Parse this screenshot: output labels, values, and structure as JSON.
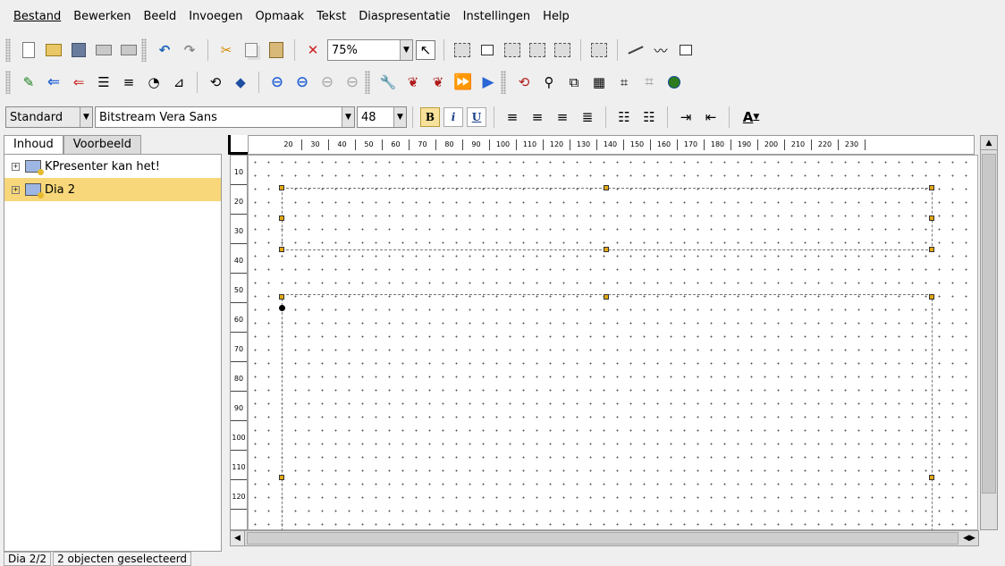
{
  "menu": [
    "Bestand",
    "Bewerken",
    "Beeld",
    "Invoegen",
    "Opmaak",
    "Tekst",
    "Diaspresentatie",
    "Instellingen",
    "Help"
  ],
  "toolbar1": {
    "zoom_value": "75%"
  },
  "format_toolbar": {
    "style_value": "Standard",
    "font_value": "Bitstream Vera Sans",
    "size_value": "48",
    "bold_label": "B",
    "italic_label": "i",
    "underline_label": "U",
    "text_color_label": "A"
  },
  "panel": {
    "tabs": [
      "Inhoud",
      "Voorbeeld"
    ],
    "slides": [
      {
        "title": "KPresenter kan het!",
        "selected": false
      },
      {
        "title": "Dia 2",
        "selected": true
      }
    ]
  },
  "rulers": {
    "horizontal_ticks": [
      "20",
      "30",
      "40",
      "50",
      "60",
      "70",
      "80",
      "90",
      "100",
      "110",
      "120",
      "130",
      "140",
      "150",
      "160",
      "170",
      "180",
      "190",
      "200",
      "210",
      "220",
      "230"
    ],
    "vertical_ticks": [
      "10",
      "20",
      "30",
      "40",
      "50",
      "60",
      "70",
      "80",
      "90",
      "100",
      "110",
      "120"
    ]
  },
  "status": {
    "slide": "Dia 2/2",
    "selection": "2 objecten geselecteerd"
  },
  "colors": {
    "accent": "#f7d77a",
    "handle": "#e4a70f"
  }
}
